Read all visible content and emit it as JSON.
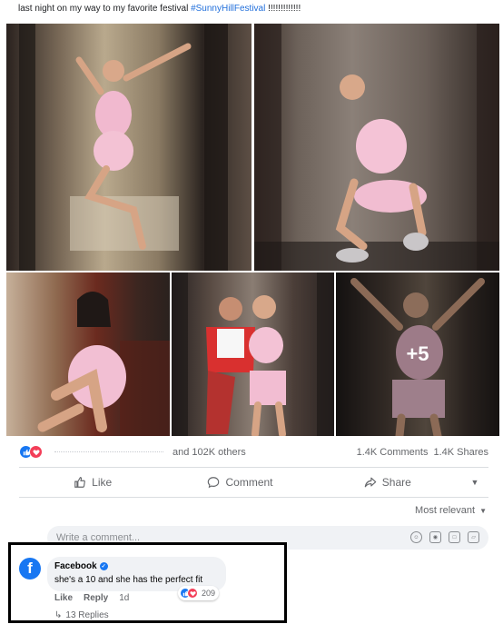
{
  "post": {
    "caption_text": "last night on my way to my favorite festival ",
    "hashtag": "#SunnyHillFestival",
    "caption_suffix": " !!!!!!!!!!!!!"
  },
  "photos": {
    "more_count": "+5"
  },
  "reactions": {
    "others_text": "and 102K others",
    "comments_count": "1.4K Comments",
    "shares_count": "1.4K Shares"
  },
  "actions": {
    "like": "Like",
    "comment": "Comment",
    "share": "Share"
  },
  "sort": {
    "label": "Most relevant"
  },
  "comment_input": {
    "placeholder": "Write a comment..."
  },
  "top_comment": {
    "avatar_letter": "f",
    "author": "Facebook",
    "text": "she's a 10 and she has the perfect fit",
    "like_label": "Like",
    "reply_label": "Reply",
    "time": "1d",
    "reaction_count": "209",
    "replies_label": "13 Replies"
  },
  "colors": {
    "brand_blue": "#1877f2",
    "love_red": "#f33e58",
    "hashtag_blue": "#216fdb"
  }
}
